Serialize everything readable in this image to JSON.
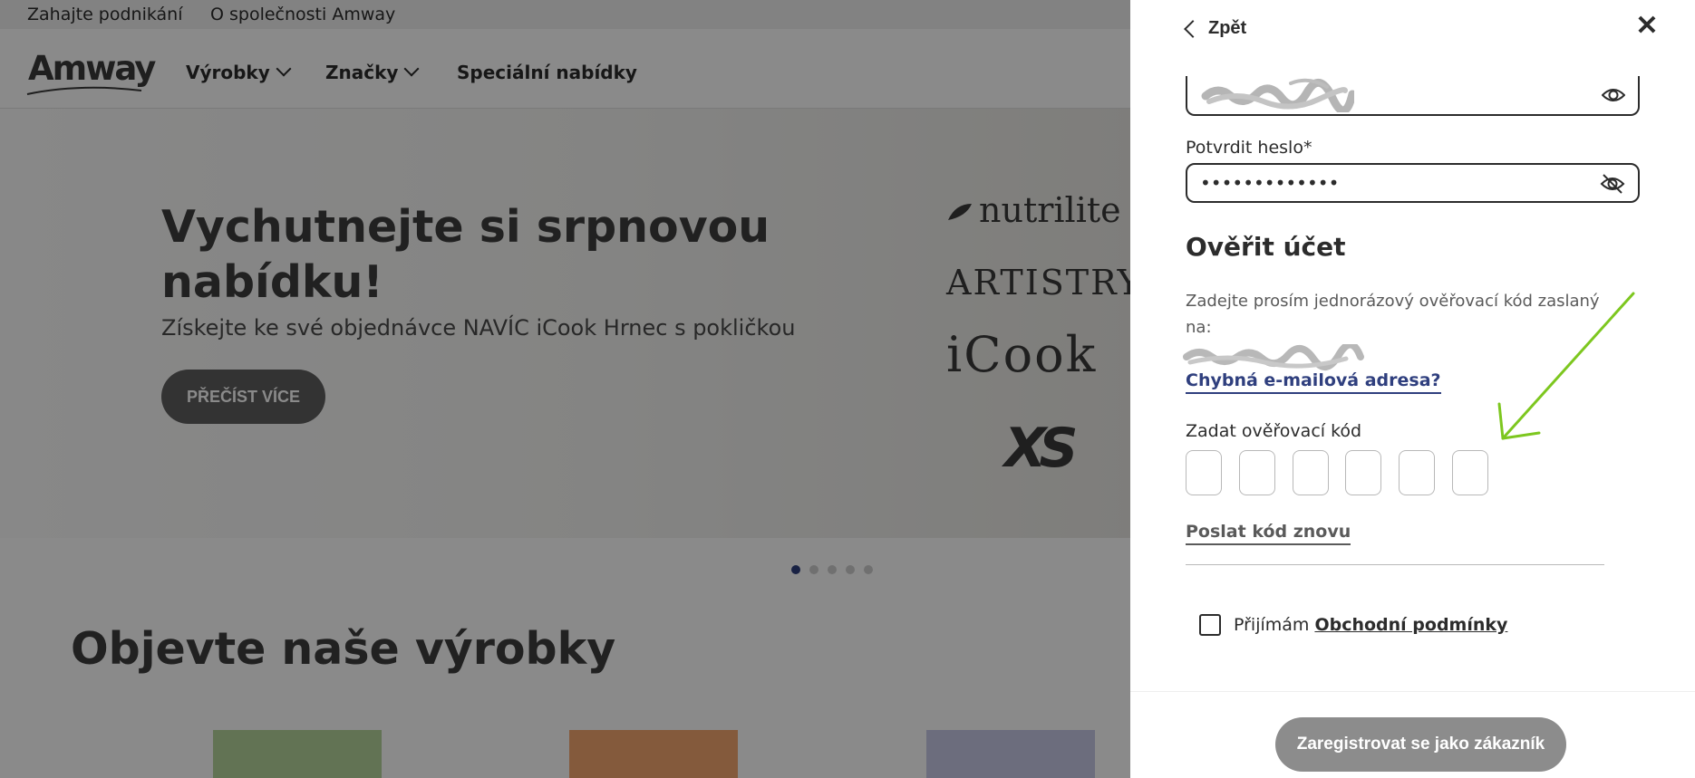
{
  "utility_bar": {
    "links": [
      "Zahajte podnikání",
      "O společnosti Amway"
    ]
  },
  "nav": {
    "logo": "Amway",
    "items": [
      "Výrobky",
      "Značky",
      "Speciální nabídky"
    ]
  },
  "hero": {
    "title": "Vychutnejte si srpnovou nabídku!",
    "subtitle": "Získejte ke své objednávce NAVÍC iCook Hrnec s pokličkou",
    "button": "PŘEČÍST VÍCE",
    "brands": [
      "nutrilite",
      "ARTISTRY",
      "iCook",
      "XS"
    ]
  },
  "carousel": {
    "slides": 5,
    "active": 1
  },
  "products": {
    "title": "Objevte naše výrobky"
  },
  "drawer": {
    "back_label": "Zpět",
    "close_label": "✕",
    "confirm_password_label": "Potvrdit heslo*",
    "confirm_password_value": "•••••••••••••",
    "verify_title": "Ověřit účet",
    "verify_desc": "Zadejte prosím jednorázový ověřovací kód zaslaný na:",
    "wrong_email_link": "Chybná e-mailová adresa?",
    "code_label": "Zadat ověřovací kód",
    "code_length": 6,
    "resend_link": "Poslat kód znovu",
    "terms_prefix": "Přijímám",
    "terms_link": "Obchodní podmínky",
    "register_button": "Zaregistrovat se jako zákazník"
  },
  "colors": {
    "link_blue": "#2f3f7e",
    "annotation_green": "#7dc71f",
    "overlay": "rgba(0,0,0,0.46)",
    "disabled_button": "#8c8c8c"
  }
}
